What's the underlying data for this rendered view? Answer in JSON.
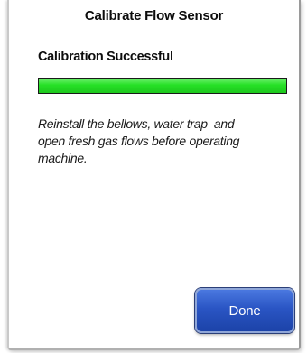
{
  "dialog": {
    "title": "Calibrate Flow Sensor",
    "status": "Calibration Successful",
    "progress": {
      "fraction": 1.0,
      "color": "#26e026"
    },
    "message": "Reinstall the bellows, water trap  and\nopen fresh gas flows before operating\nmachine.",
    "done_label": "Done",
    "done_color": "#2a55c4"
  }
}
